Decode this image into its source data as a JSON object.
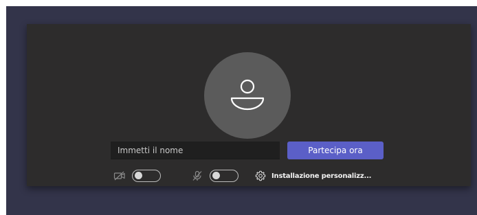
{
  "prejoin": {
    "avatar_icon": "person-icon",
    "name_input": {
      "placeholder": "Immetti il nome",
      "value": ""
    },
    "join_button_label": "Partecipa ora",
    "controls": {
      "camera": {
        "icon": "camera-off-icon",
        "on": false
      },
      "microphone": {
        "icon": "microphone-off-icon",
        "on": false
      },
      "custom_setup": {
        "icon": "gear-icon",
        "label": "Installazione personalizz..."
      }
    }
  },
  "colors": {
    "background": "#33344a",
    "panel": "#2d2c2c",
    "avatar": "#5b5b5b",
    "accent": "#5b5fc7"
  }
}
